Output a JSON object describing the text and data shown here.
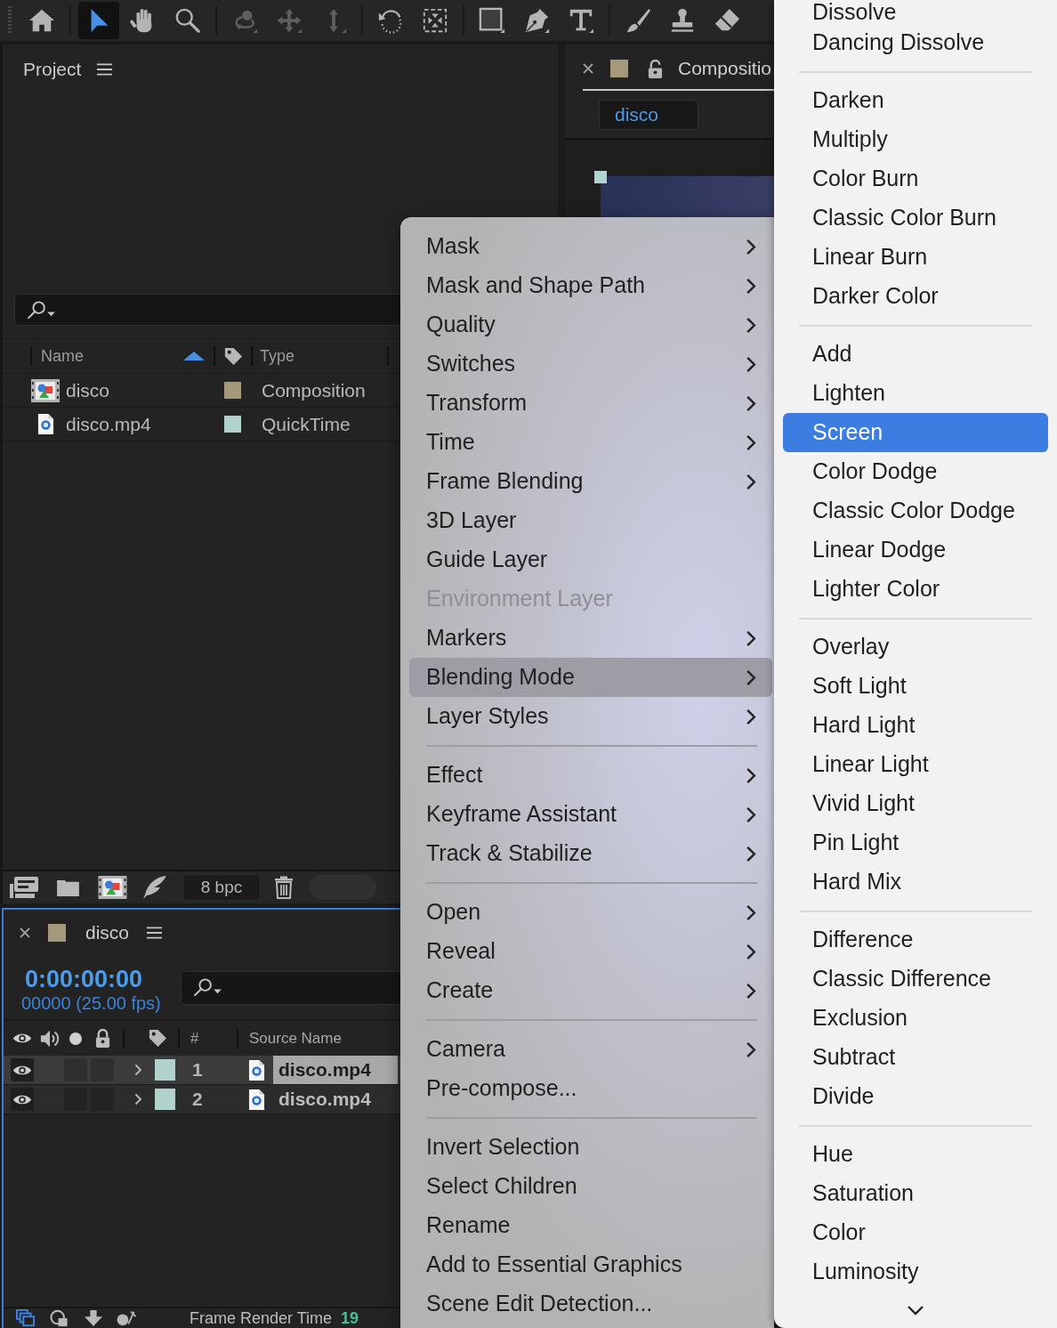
{
  "toolbar": {
    "groups": [
      {
        "tools": [
          {
            "kind": "home",
            "selected": false,
            "disabled": false
          }
        ]
      },
      {
        "tools": [
          {
            "kind": "selection",
            "selected": true,
            "disabled": false
          },
          {
            "kind": "hand",
            "selected": false,
            "disabled": false
          },
          {
            "kind": "zoom",
            "selected": false,
            "disabled": false
          }
        ]
      },
      {
        "tools": [
          {
            "kind": "orbit",
            "selected": false,
            "disabled": true
          },
          {
            "kind": "move",
            "selected": false,
            "disabled": true
          },
          {
            "kind": "axis",
            "selected": false,
            "disabled": true
          }
        ]
      },
      {
        "tools": [
          {
            "kind": "rotate",
            "selected": false,
            "disabled": false
          },
          {
            "kind": "region",
            "selected": false,
            "disabled": false
          }
        ]
      },
      {
        "tools": [
          {
            "kind": "rectangle",
            "selected": false,
            "disabled": false
          },
          {
            "kind": "pen",
            "selected": false,
            "disabled": false
          },
          {
            "kind": "type",
            "selected": false,
            "disabled": false
          }
        ]
      },
      {
        "tools": [
          {
            "kind": "brush",
            "selected": false,
            "disabled": false
          },
          {
            "kind": "stamp",
            "selected": false,
            "disabled": false
          },
          {
            "kind": "eraser",
            "selected": false,
            "disabled": false
          }
        ]
      }
    ]
  },
  "project": {
    "title": "Project",
    "columns": [
      {
        "label": "Name",
        "sorted": true
      },
      {
        "label": "Type",
        "sorted": false
      }
    ],
    "items": [
      {
        "kind": "composition",
        "name": "disco",
        "color": "#a6987a",
        "type": "Composition"
      },
      {
        "kind": "footage",
        "name": "disco.mp4",
        "color": "#b1d1cc",
        "type": "QuickTime"
      }
    ],
    "bit_depth": "8 bpc"
  },
  "composition_viewer": {
    "tab": {
      "title": "Compositio",
      "color": "#a6987a",
      "locked": false
    },
    "breadcrumb": "disco"
  },
  "timeline": {
    "tab": {
      "title": "disco",
      "color": "#a6987a"
    },
    "timecode": "0:00:00:00",
    "frame_info": "00000 (25.00 fps)",
    "columns": {
      "number": "#",
      "source_name": "Source Name"
    },
    "layers": [
      {
        "number": "1",
        "name": "disco.mp4",
        "visible": true,
        "expanded": false,
        "selected": true,
        "color": "#b1d1cc"
      },
      {
        "number": "2",
        "name": "disco.mp4",
        "visible": true,
        "expanded": false,
        "selected": false,
        "color": "#b1d1cc"
      }
    ],
    "status": {
      "label": "Frame Render Time",
      "value": "19"
    }
  },
  "context_menu": {
    "sections": [
      {
        "items": [
          {
            "label": "Mask",
            "submenu": true,
            "disabled": false,
            "selected": false
          },
          {
            "label": "Mask and Shape Path",
            "submenu": true,
            "disabled": false,
            "selected": false
          },
          {
            "label": "Quality",
            "submenu": true,
            "disabled": false,
            "selected": false
          },
          {
            "label": "Switches",
            "submenu": true,
            "disabled": false,
            "selected": false
          },
          {
            "label": "Transform",
            "submenu": true,
            "disabled": false,
            "selected": false
          },
          {
            "label": "Time",
            "submenu": true,
            "disabled": false,
            "selected": false
          },
          {
            "label": "Frame Blending",
            "submenu": true,
            "disabled": false,
            "selected": false
          },
          {
            "label": "3D Layer",
            "submenu": false,
            "disabled": false,
            "selected": false
          },
          {
            "label": "Guide Layer",
            "submenu": false,
            "disabled": false,
            "selected": false
          },
          {
            "label": "Environment Layer",
            "submenu": false,
            "disabled": true,
            "selected": false
          },
          {
            "label": "Markers",
            "submenu": true,
            "disabled": false,
            "selected": false
          },
          {
            "label": "Blending Mode",
            "submenu": true,
            "disabled": false,
            "selected": true
          },
          {
            "label": "Layer Styles",
            "submenu": true,
            "disabled": false,
            "selected": false
          }
        ]
      },
      {
        "items": [
          {
            "label": "Effect",
            "submenu": true,
            "disabled": false,
            "selected": false
          },
          {
            "label": "Keyframe Assistant",
            "submenu": true,
            "disabled": false,
            "selected": false
          },
          {
            "label": "Track & Stabilize",
            "submenu": true,
            "disabled": false,
            "selected": false
          }
        ]
      },
      {
        "items": [
          {
            "label": "Open",
            "submenu": true,
            "disabled": false,
            "selected": false
          },
          {
            "label": "Reveal",
            "submenu": true,
            "disabled": false,
            "selected": false
          },
          {
            "label": "Create",
            "submenu": true,
            "disabled": false,
            "selected": false
          }
        ]
      },
      {
        "items": [
          {
            "label": "Camera",
            "submenu": true,
            "disabled": false,
            "selected": false
          },
          {
            "label": "Pre-compose...",
            "submenu": false,
            "disabled": false,
            "selected": false
          }
        ]
      },
      {
        "items": [
          {
            "label": "Invert Selection",
            "submenu": false,
            "disabled": false,
            "selected": false
          },
          {
            "label": "Select Children",
            "submenu": false,
            "disabled": false,
            "selected": false
          },
          {
            "label": "Rename",
            "submenu": false,
            "disabled": false,
            "selected": false
          },
          {
            "label": "Add to Essential Graphics",
            "submenu": false,
            "disabled": false,
            "selected": false
          },
          {
            "label": "Scene Edit Detection...",
            "submenu": false,
            "disabled": false,
            "selected": false
          }
        ]
      }
    ]
  },
  "blend_submenu": {
    "sections": [
      {
        "items": [
          {
            "label": "Dissolve",
            "selected": false
          },
          {
            "label": "Dancing Dissolve",
            "selected": false
          }
        ]
      },
      {
        "items": [
          {
            "label": "Darken",
            "selected": false
          },
          {
            "label": "Multiply",
            "selected": false
          },
          {
            "label": "Color Burn",
            "selected": false
          },
          {
            "label": "Classic Color Burn",
            "selected": false
          },
          {
            "label": "Linear Burn",
            "selected": false
          },
          {
            "label": "Darker Color",
            "selected": false
          }
        ]
      },
      {
        "items": [
          {
            "label": "Add",
            "selected": false
          },
          {
            "label": "Lighten",
            "selected": false
          },
          {
            "label": "Screen",
            "selected": true
          },
          {
            "label": "Color Dodge",
            "selected": false
          },
          {
            "label": "Classic Color Dodge",
            "selected": false
          },
          {
            "label": "Linear Dodge",
            "selected": false
          },
          {
            "label": "Lighter Color",
            "selected": false
          }
        ]
      },
      {
        "items": [
          {
            "label": "Overlay",
            "selected": false
          },
          {
            "label": "Soft Light",
            "selected": false
          },
          {
            "label": "Hard Light",
            "selected": false
          },
          {
            "label": "Linear Light",
            "selected": false
          },
          {
            "label": "Vivid Light",
            "selected": false
          },
          {
            "label": "Pin Light",
            "selected": false
          },
          {
            "label": "Hard Mix",
            "selected": false
          }
        ]
      },
      {
        "items": [
          {
            "label": "Difference",
            "selected": false
          },
          {
            "label": "Classic Difference",
            "selected": false
          },
          {
            "label": "Exclusion",
            "selected": false
          },
          {
            "label": "Subtract",
            "selected": false
          },
          {
            "label": "Divide",
            "selected": false
          }
        ]
      },
      {
        "items": [
          {
            "label": "Hue",
            "selected": false
          },
          {
            "label": "Saturation",
            "selected": false
          },
          {
            "label": "Color",
            "selected": false
          },
          {
            "label": "Luminosity",
            "selected": false
          }
        ]
      }
    ],
    "more_below": true
  }
}
